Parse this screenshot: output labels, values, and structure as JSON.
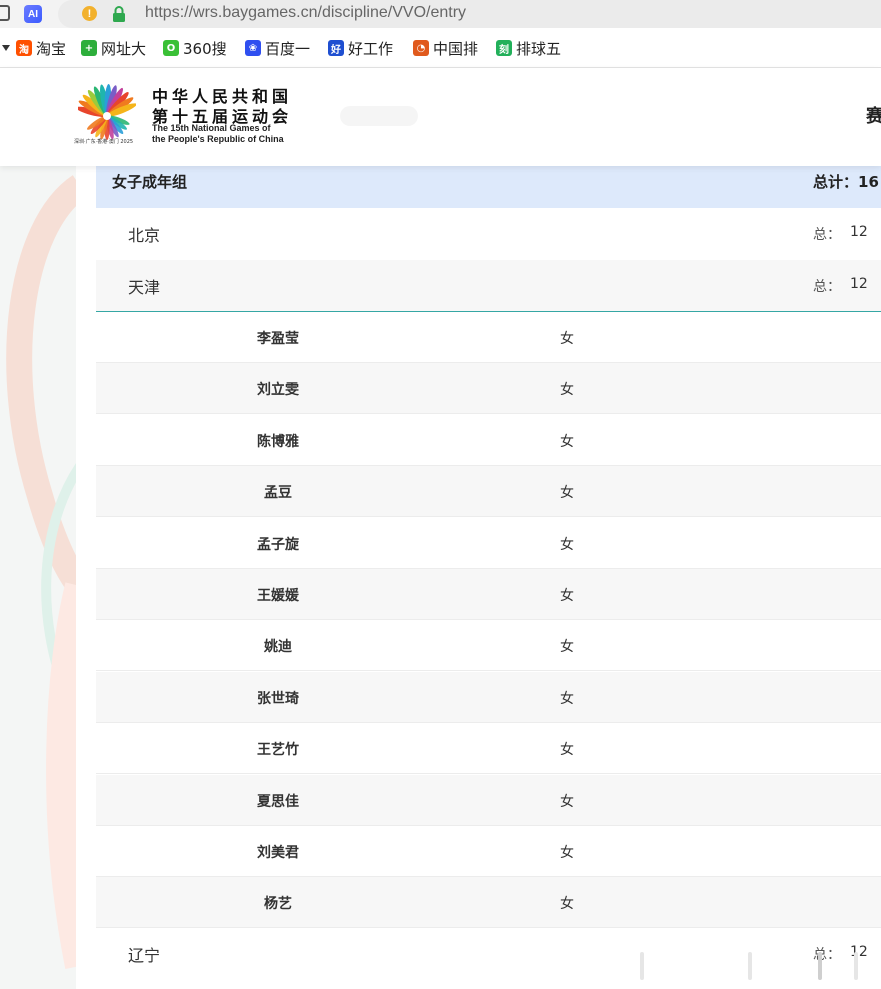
{
  "browser": {
    "ai_badge": "AI",
    "warning_mark": "!",
    "url": "https://wrs.baygames.cn/discipline/VVO/entry",
    "bookmarks": [
      {
        "label": "淘宝",
        "icon": "taobao-icon",
        "color": "#ff5000",
        "glyph": "淘"
      },
      {
        "label": "网址大",
        "icon": "hao-navigation-icon",
        "color": "#2dae3b",
        "glyph": "+"
      },
      {
        "label": "360搜",
        "icon": "360-search-icon",
        "color": "#3ac036",
        "glyph": "O"
      },
      {
        "label": "百度一",
        "icon": "baidu-paw-icon",
        "color": "#2f4ff0",
        "glyph": "❀"
      },
      {
        "label": "好工作",
        "icon": "job-site-icon",
        "color": "#1f4fd1",
        "glyph": "好"
      },
      {
        "label": "中国排",
        "icon": "volleyball-site-icon",
        "color": "#e05a1d",
        "glyph": "◔"
      },
      {
        "label": "排球五",
        "icon": "volleyball-five-icon",
        "color": "#22b05a",
        "glyph": "刻"
      }
    ]
  },
  "header": {
    "logo_cn_line1": "中华人民共和国",
    "logo_cn_line2": "第十五届运动会",
    "logo_en_line1": "The 15th National Games of",
    "logo_en_line2": "the People's Republic of China",
    "logo_tagline": "深圳·广东·香港·澳门 2025",
    "nav_partial": "赛"
  },
  "group": {
    "title": "女子成年组",
    "total_label": "总计：",
    "total_value": "16"
  },
  "provinces": [
    {
      "name": "北京",
      "total_label": "总：",
      "total_value": "12"
    },
    {
      "name": "天津",
      "total_label": "总：",
      "total_value": "12"
    },
    {
      "name": "辽宁",
      "total_label": "总：",
      "total_value": "12"
    }
  ],
  "players": [
    {
      "name": "李盈莹",
      "gender": "女"
    },
    {
      "name": "刘立雯",
      "gender": "女"
    },
    {
      "name": "陈博雅",
      "gender": "女"
    },
    {
      "name": "孟豆",
      "gender": "女"
    },
    {
      "name": "孟子旋",
      "gender": "女"
    },
    {
      "name": "王媛媛",
      "gender": "女"
    },
    {
      "name": "姚迪",
      "gender": "女"
    },
    {
      "name": "张世琦",
      "gender": "女"
    },
    {
      "name": "王艺竹",
      "gender": "女"
    },
    {
      "name": "夏思佳",
      "gender": "女"
    },
    {
      "name": "刘美君",
      "gender": "女"
    },
    {
      "name": "杨艺",
      "gender": "女"
    }
  ]
}
